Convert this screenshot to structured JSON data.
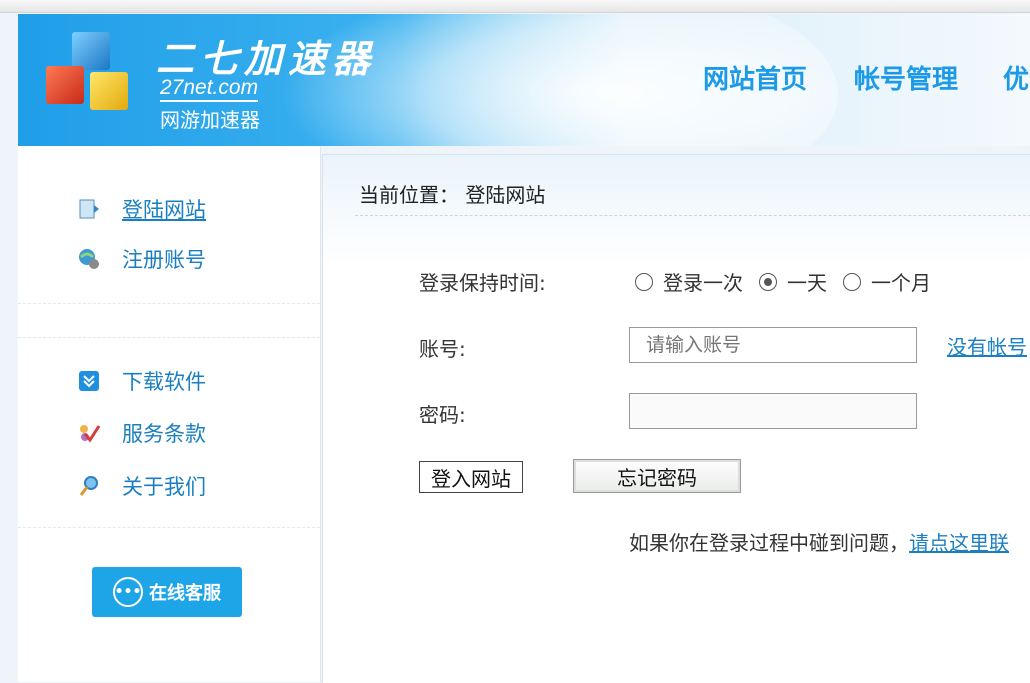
{
  "header": {
    "logo_cn": "二七加速器",
    "logo_en": "27net.com",
    "logo_sub": "网游加速器",
    "nav": [
      "网站首页",
      "帐号管理",
      "优"
    ]
  },
  "sidebar": {
    "items": [
      {
        "label": "登陆网站",
        "icon": "document-icon"
      },
      {
        "label": "注册账号",
        "icon": "user-globe-icon"
      },
      {
        "label": "下载软件",
        "icon": "download-icon"
      },
      {
        "label": "服务条款",
        "icon": "checkmark-icon"
      },
      {
        "label": "关于我们",
        "icon": "magnifier-icon"
      }
    ],
    "support_button": "在线客服"
  },
  "main": {
    "breadcrumb": "当前位置： 登陆网站",
    "keep_label": "登录保持时间:",
    "keep_options": [
      "登录一次",
      "一天",
      "一个月"
    ],
    "keep_selected": "一天",
    "account_label": "账号:",
    "account_placeholder": "请输入账号",
    "no_account_link": "没有帐号",
    "password_label": "密码:",
    "login_button": "登入网站",
    "forgot_button": "忘记密码",
    "help_text": "如果你在登录过程中碰到问题，",
    "help_link": "请点这里联"
  },
  "colors": {
    "accent": "#1c9ae6",
    "link": "#1a7fc1",
    "banner": "#1f9ee8"
  }
}
